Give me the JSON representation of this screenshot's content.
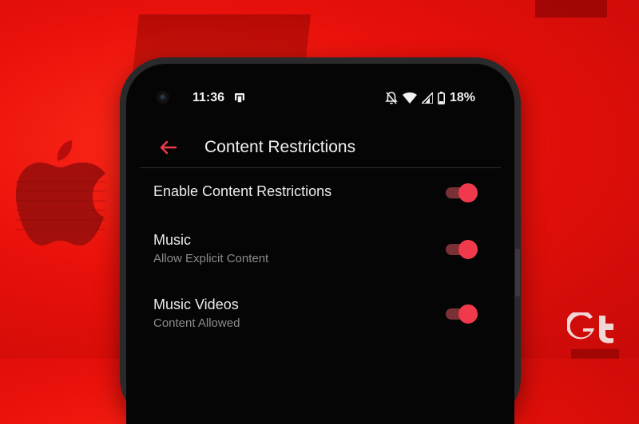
{
  "status_bar": {
    "time": "11:36",
    "battery_percent": "18%",
    "icons": [
      "notification-app-icon",
      "bell-off-icon",
      "wifi-icon",
      "cell-signal-icon",
      "battery-icon"
    ]
  },
  "app_bar": {
    "title": "Content Restrictions",
    "back_icon": "arrow-left-icon"
  },
  "settings": [
    {
      "title": "Enable Content Restrictions",
      "subtitle": "",
      "enabled": true
    },
    {
      "title": "Music",
      "subtitle": "Allow Explicit Content",
      "enabled": true
    },
    {
      "title": "Music Videos",
      "subtitle": "Content Allowed",
      "enabled": true
    }
  ],
  "colors": {
    "accent": "#f03a4c",
    "toggle_track": "#7a3136",
    "background_red": "#e8100a",
    "screen_bg": "#050505"
  },
  "decorations": {
    "left_logo": "apple-logo",
    "right_logo": "gt-logo"
  }
}
